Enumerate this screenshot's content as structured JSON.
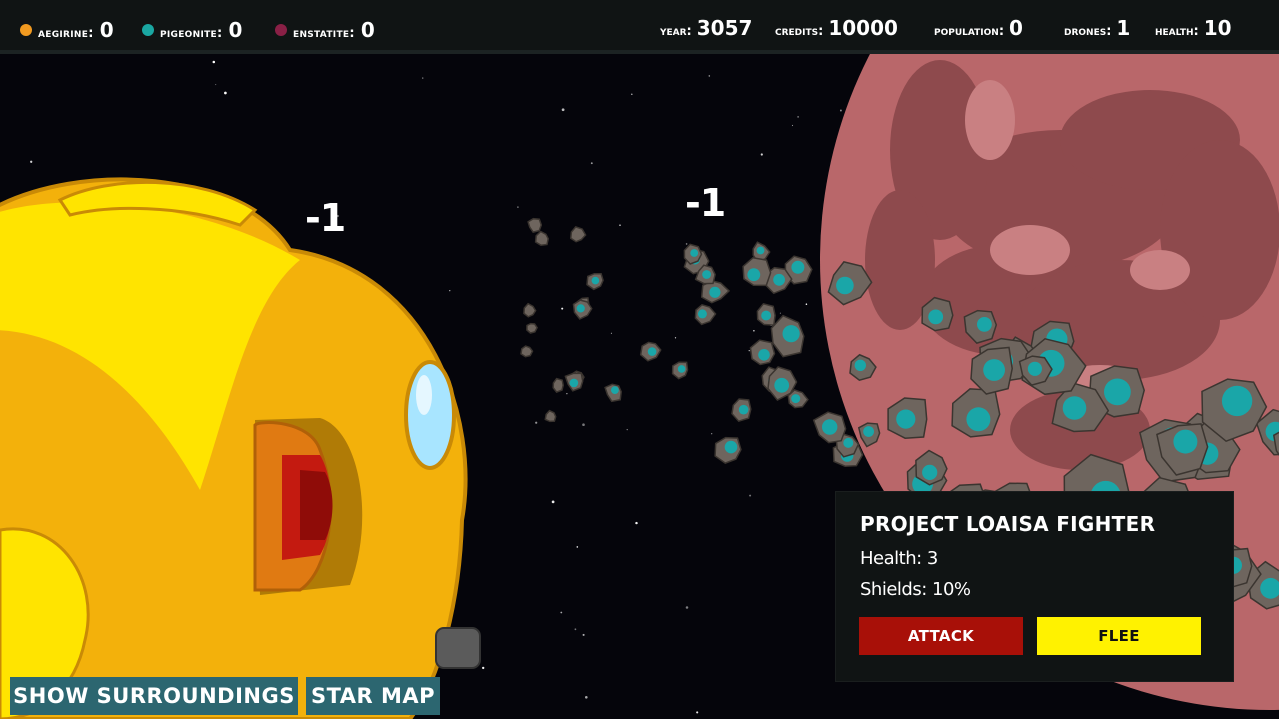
{
  "resources": [
    {
      "label": "aegirine:",
      "value": "0",
      "color": "#f19a20"
    },
    {
      "label": "pigeonite:",
      "value": "0",
      "color": "#1aa7a2"
    },
    {
      "label": "enstatite:",
      "value": "0",
      "color": "#8a2046"
    }
  ],
  "stats": {
    "year_label": "year:",
    "year": "3057",
    "credits_label": "credits:",
    "credits": "10000",
    "population_label": "population:",
    "population": "0",
    "drones_label": "drones:",
    "drones": "1",
    "health_label": "health:",
    "health": "10"
  },
  "damage_numbers": [
    "-1",
    "-1"
  ],
  "encounter": {
    "title": "PROJECT LOAISA FIGHTER",
    "health": "Health: 3",
    "shields": "Shields: 10%",
    "attack_label": "ATTACK",
    "flee_label": "FLEE"
  },
  "nav": {
    "surroundings_label": "SHOW SURROUNDINGS",
    "starmap_label": "STAR MAP"
  },
  "colors": {
    "planet": "#b9676a",
    "ship": "#f3b10b",
    "asteroid": "#6e655e",
    "crystal": "#1aa6a8"
  }
}
